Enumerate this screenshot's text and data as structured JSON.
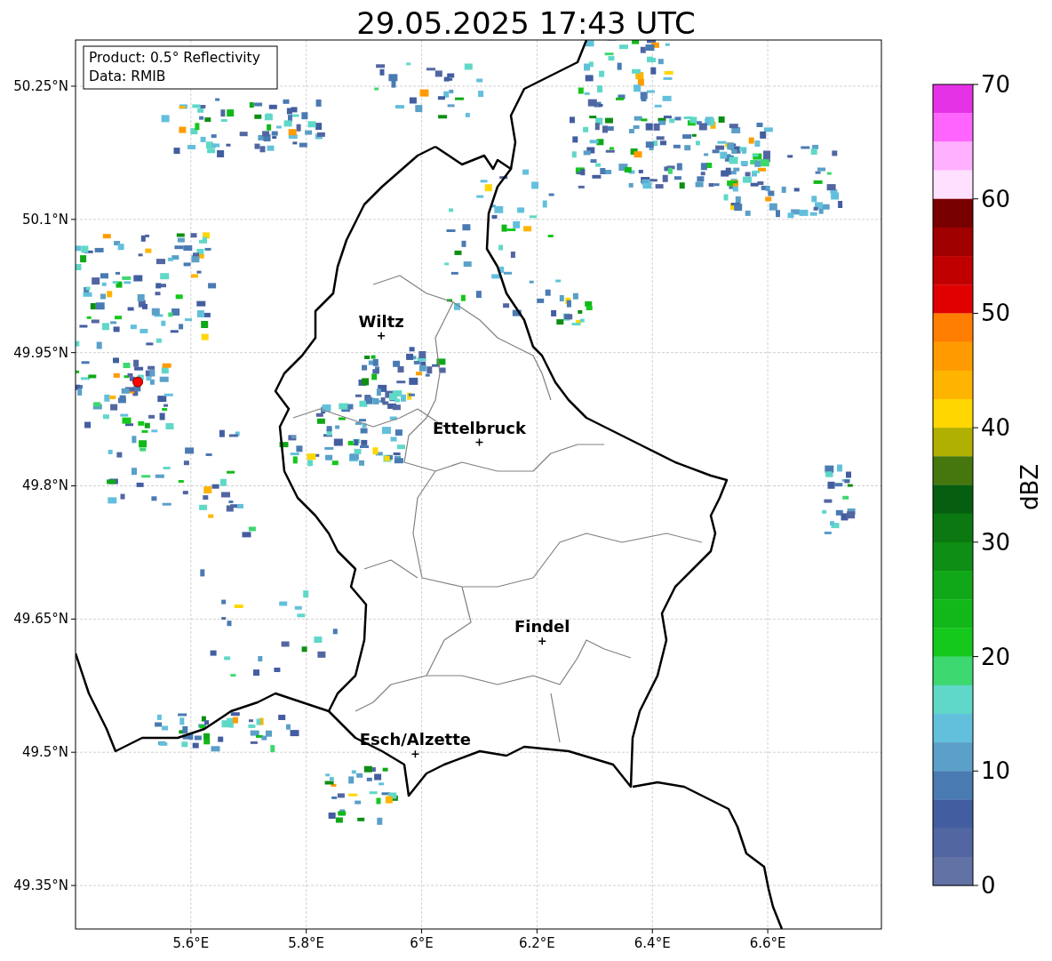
{
  "title": "29.05.2025 17:43 UTC",
  "info_box": [
    "Product: 0.5° Reflectivity",
    "Data: RMIB"
  ],
  "map": {
    "latitude_labels": [
      "50.25°N",
      "50.1°N",
      "49.95°N",
      "49.8°N",
      "49.65°N",
      "49.5°N",
      "49.35°N"
    ],
    "longitude_labels": [
      "5.6°E",
      "5.8°E",
      "6°E",
      "6.2°E",
      "6.4°E",
      "6.6°E"
    ],
    "cities": [
      "Wiltz",
      "Ettelbruck",
      "Findel",
      "Esch/Alzette"
    ]
  },
  "colorbar": {
    "label": "dBZ",
    "ticks": [
      "70",
      "60",
      "50",
      "40",
      "30",
      "20",
      "10",
      "0"
    ],
    "bands": [
      {
        "color": "#e632e6"
      },
      {
        "color": "#ff64ff"
      },
      {
        "color": "#ffb0ff"
      },
      {
        "color": "#ffe0ff"
      },
      {
        "color": "#780000"
      },
      {
        "color": "#a00000"
      },
      {
        "color": "#c00000"
      },
      {
        "color": "#e00000"
      },
      {
        "color": "#ff7d00"
      },
      {
        "color": "#ff9b00"
      },
      {
        "color": "#ffb400"
      },
      {
        "color": "#ffd700"
      },
      {
        "color": "#b0b000"
      },
      {
        "color": "#46770e"
      },
      {
        "color": "#065e10"
      },
      {
        "color": "#0b7812"
      },
      {
        "color": "#0e8e14"
      },
      {
        "color": "#10a818"
      },
      {
        "color": "#12b81a"
      },
      {
        "color": "#14c81c"
      },
      {
        "color": "#3ed870"
      },
      {
        "color": "#60d8c8"
      },
      {
        "color": "#63c0dc"
      },
      {
        "color": "#5aa0c8"
      },
      {
        "color": "#4a7ab2"
      },
      {
        "color": "#435ea0"
      },
      {
        "color": "#5266a2"
      },
      {
        "color": "#6272a4"
      }
    ]
  }
}
